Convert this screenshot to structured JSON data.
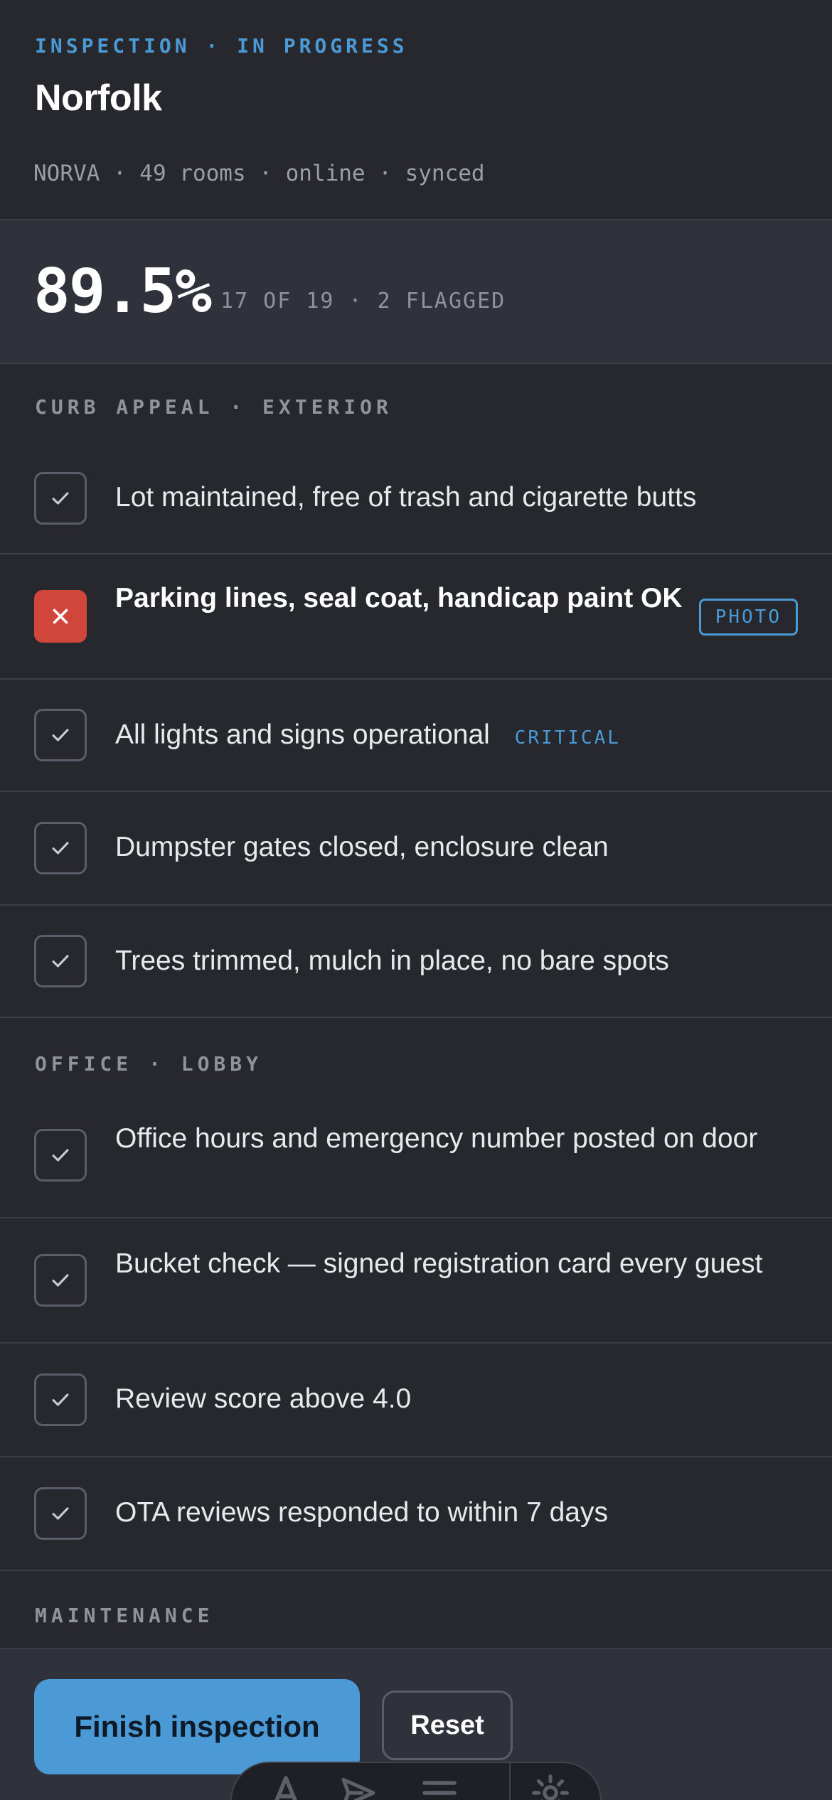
{
  "header": {
    "eyebrow": "INSPECTION · IN PROGRESS",
    "title": "Norfolk",
    "meta": "NORVA · 49 rooms · online · synced"
  },
  "score": {
    "percent": "89.5%",
    "summary": "17 OF 19 · 2 FLAGGED"
  },
  "sections": [
    {
      "title": "CURB APPEAL · EXTERIOR",
      "items": [
        {
          "label": "Lot maintained, free of trash and cigarette butts",
          "status": "checked"
        },
        {
          "label": "Parking lines, seal coat, handicap paint OK",
          "status": "flagged",
          "tag": "PHOTO"
        },
        {
          "label": "All lights and signs operational",
          "status": "checked",
          "tag": "CRITICAL"
        },
        {
          "label": "Dumpster gates closed, enclosure clean",
          "status": "checked"
        },
        {
          "label": "Trees trimmed, mulch in place, no bare spots",
          "status": "checked"
        }
      ]
    },
    {
      "title": "OFFICE · LOBBY",
      "items": [
        {
          "label": "Office hours and emergency number posted on door",
          "status": "checked"
        },
        {
          "label": "Bucket check — signed registration card every guest",
          "status": "checked"
        },
        {
          "label": "Review score above 4.0",
          "status": "checked"
        },
        {
          "label": "OTA reviews responded to within 7 days",
          "status": "checked"
        }
      ]
    },
    {
      "title": "MAINTENANCE",
      "items": []
    }
  ],
  "actions": {
    "finish_label": "Finish inspection",
    "reset_label": "Reset"
  },
  "dock": {
    "icons": [
      "text-icon",
      "send-icon",
      "menu-icon",
      "gear-icon"
    ]
  },
  "colors": {
    "accent": "#4b9ad6",
    "flag": "#d1463b",
    "background": "#26282e"
  }
}
